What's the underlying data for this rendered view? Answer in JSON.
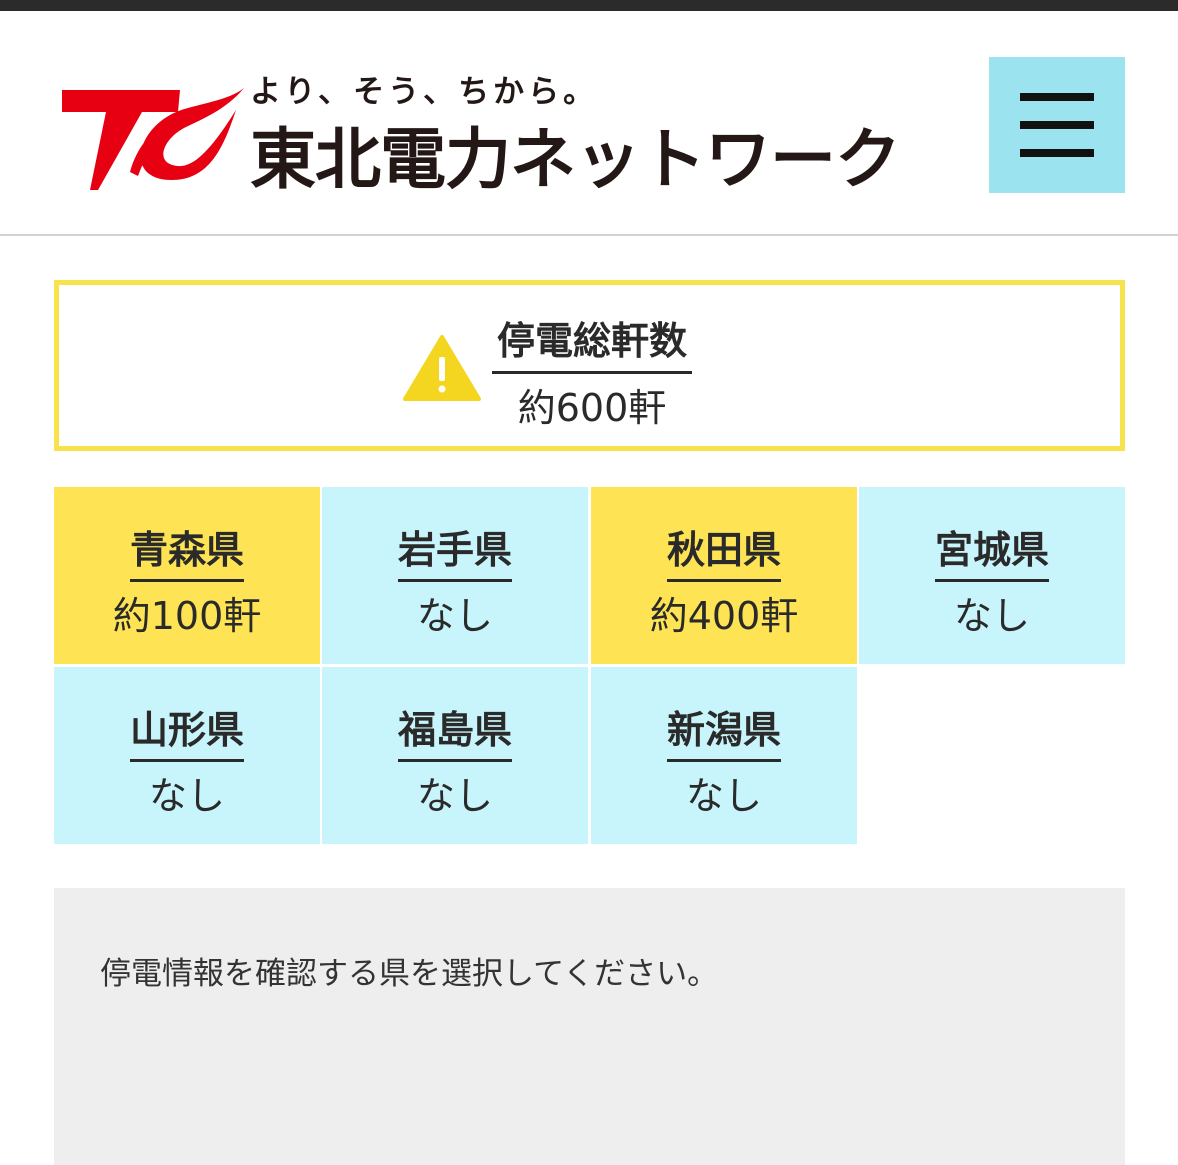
{
  "header": {
    "tagline": "より、そう、ちから。",
    "company_name": "東北電力ネットワーク",
    "logo_icon": "tohoku-electric-logo-icon",
    "menu_icon": "hamburger-menu-icon"
  },
  "summary": {
    "title": "停電総軒数",
    "value": "約600軒",
    "icon": "warning-triangle-icon"
  },
  "prefectures": [
    {
      "name": "青森県",
      "value": "約100軒",
      "status": "outage"
    },
    {
      "name": "岩手県",
      "value": "なし",
      "status": "none"
    },
    {
      "name": "秋田県",
      "value": "約400軒",
      "status": "outage"
    },
    {
      "name": "宮城県",
      "value": "なし",
      "status": "none"
    },
    {
      "name": "山形県",
      "value": "なし",
      "status": "none"
    },
    {
      "name": "福島県",
      "value": "なし",
      "status": "none"
    },
    {
      "name": "新潟県",
      "value": "なし",
      "status": "none"
    }
  ],
  "info": {
    "message": "停電情報を確認する県を選択してください。"
  },
  "colors": {
    "outage": "#fee455",
    "none": "#c8f5fb",
    "menu_button": "#9be3ee",
    "summary_border": "#f9e34d",
    "brand_red": "#e60012"
  }
}
